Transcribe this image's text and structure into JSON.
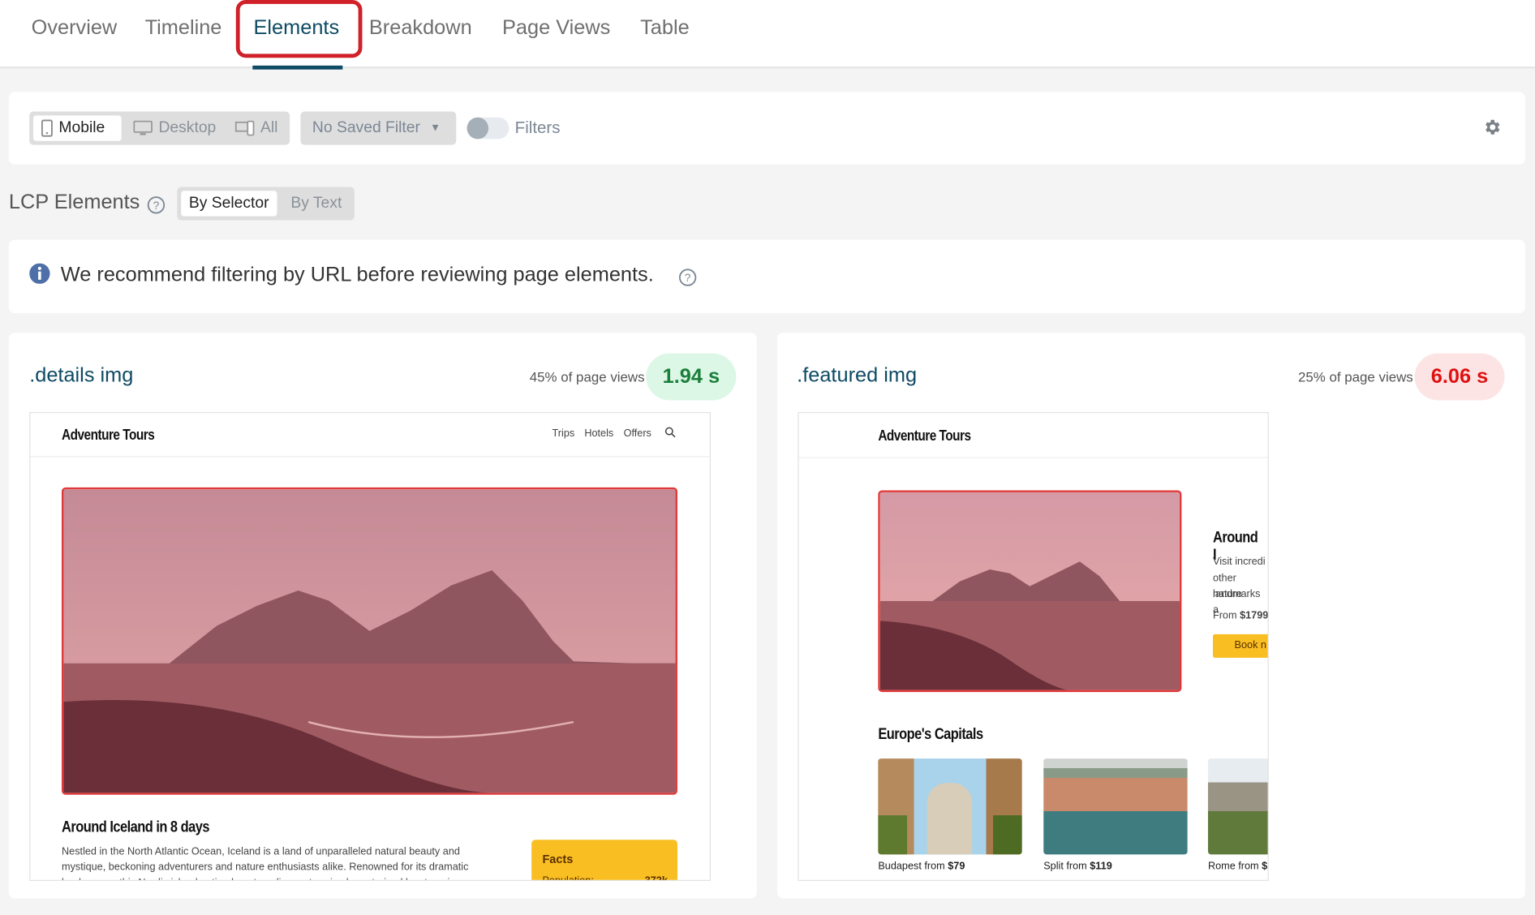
{
  "tabs": [
    {
      "label": "Overview"
    },
    {
      "label": "Timeline"
    },
    {
      "label": "Elements",
      "active": true
    },
    {
      "label": "Breakdown"
    },
    {
      "label": "Page Views"
    },
    {
      "label": "Table"
    }
  ],
  "toolbar": {
    "devices": [
      {
        "label": "Mobile",
        "icon": "mobile-icon",
        "active": true
      },
      {
        "label": "Desktop",
        "icon": "desktop-icon"
      },
      {
        "label": "All",
        "icon": "all-devices-icon"
      }
    ],
    "saved_filter": "No Saved Filter",
    "filters_label": "Filters",
    "filters_enabled": false,
    "settings_icon": "gear-icon"
  },
  "section": {
    "title": "LCP Elements",
    "modes": [
      {
        "label": "By Selector",
        "active": true
      },
      {
        "label": "By Text"
      }
    ]
  },
  "notice": {
    "text": "We recommend filtering by URL before reviewing page elements.",
    "icon": "info-icon"
  },
  "colors": {
    "accent": "#0d4a63",
    "good_bg": "#dcf7e6",
    "good_text": "#1a7f3a",
    "poor_bg": "#fde4e4",
    "poor_text": "#e01010",
    "highlight": "#d0202a"
  },
  "elements": [
    {
      "selector": ".details img",
      "share": "45% of page views",
      "value": "1.94 s",
      "rating": "good",
      "preview": {
        "brand": "Adventure Tours",
        "nav": [
          "Trips",
          "Hotels",
          "Offers"
        ],
        "heading": "Around Iceland in 8 days",
        "body": "Nestled in the North Atlantic Ocean, Iceland is a land of unparalleled natural beauty and mystique, beckoning adventurers and nature enthusiasts alike. Renowned for its dramatic landscapes, this Nordic island nation boasts a diverse terrain characterized by steaming geysers",
        "facts_title": "Facts",
        "facts_row": "Population:",
        "facts_value": "372k"
      }
    },
    {
      "selector": ".featured img",
      "share": "25% of page views",
      "value": "6.06 s",
      "rating": "poor",
      "preview": {
        "brand": "Adventure Tours",
        "heading": "Around I",
        "lines": [
          "Visit incredi",
          "other nature",
          "landmarks a"
        ],
        "price_prefix": "From ",
        "price": "$1799",
        "cta": "Book n",
        "section": "Europe's Capitals",
        "cities": [
          {
            "name": "Budapest from ",
            "price": "$79"
          },
          {
            "name": "Split from ",
            "price": "$119"
          },
          {
            "name": "Rome from ",
            "price": "$"
          }
        ]
      }
    }
  ]
}
